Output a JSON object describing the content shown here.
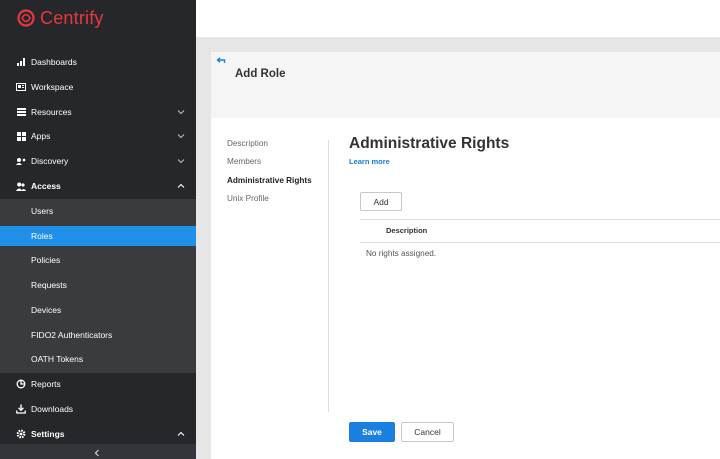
{
  "app": {
    "brand": "Centrify",
    "brand_color": "#e8383d",
    "accent": "#1f8fe8"
  },
  "sidebar": {
    "items": [
      {
        "label": "Dashboards",
        "icon": "bar-chart-icon"
      },
      {
        "label": "Workspace",
        "icon": "workspace-icon"
      },
      {
        "label": "Resources",
        "icon": "list-icon",
        "expandable": true
      },
      {
        "label": "Apps",
        "icon": "grid-icon",
        "expandable": true
      },
      {
        "label": "Discovery",
        "icon": "discovery-icon",
        "expandable": true
      },
      {
        "label": "Access",
        "icon": "users-icon",
        "expanded": true
      }
    ],
    "access_sub": [
      {
        "label": "Users"
      },
      {
        "label": "Roles",
        "active": true
      },
      {
        "label": "Policies"
      },
      {
        "label": "Requests"
      },
      {
        "label": "Devices"
      },
      {
        "label": "FIDO2 Authenticators"
      },
      {
        "label": "OATH Tokens"
      }
    ],
    "bottom_items": [
      {
        "label": "Reports",
        "icon": "reports-icon"
      },
      {
        "label": "Downloads",
        "icon": "download-icon"
      },
      {
        "label": "Settings",
        "icon": "gear-icon",
        "expanded": true
      }
    ]
  },
  "panel": {
    "title": "Add Role",
    "nav": [
      "Description",
      "Members",
      "Administrative Rights",
      "Unix Profile"
    ],
    "current_nav": "Administrative Rights"
  },
  "content": {
    "title": "Administrative Rights",
    "learn_more": "Learn more",
    "add_label": "Add",
    "column_header": "Description",
    "empty_message": "No rights assigned."
  },
  "footer": {
    "save_label": "Save",
    "cancel_label": "Cancel"
  }
}
